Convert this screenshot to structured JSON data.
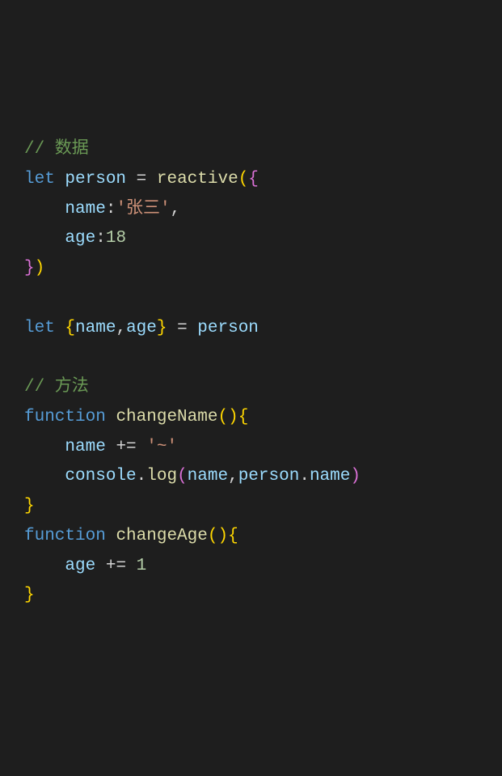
{
  "lines": {
    "l1_comment": "// 数据",
    "l2_let": "let",
    "l2_person": "person",
    "l2_eq": " = ",
    "l2_reactive": "reactive",
    "l2_paren_open": "(",
    "l2_brace_open": "{",
    "l3_indent": "    ",
    "l3_name_key": "name",
    "l3_colon": ":",
    "l3_name_val": "'张三'",
    "l3_comma": ",",
    "l4_indent": "    ",
    "l4_age_key": "age",
    "l4_colon": ":",
    "l4_age_val": "18",
    "l5_brace_close": "}",
    "l5_paren_close": ")",
    "l7_let": "let",
    "l7_brace_open": "{",
    "l7_name": "name",
    "l7_comma": ",",
    "l7_age": "age",
    "l7_brace_close": "}",
    "l7_eq": " = ",
    "l7_person": "person",
    "l9_comment": "// 方法",
    "l10_function": "function",
    "l10_fname": "changeName",
    "l10_parens": "()",
    "l10_brace": "{",
    "l11_indent": "    ",
    "l11_name": "name",
    "l11_op": " += ",
    "l11_val": "'~'",
    "l12_indent": "    ",
    "l12_console": "console",
    "l12_dot1": ".",
    "l12_log": "log",
    "l12_paren_open": "(",
    "l12_name": "name",
    "l12_comma": ",",
    "l12_person": "person",
    "l12_dot2": ".",
    "l12_pname": "name",
    "l12_paren_close": ")",
    "l13_brace": "}",
    "l14_function": "function",
    "l14_fname": "changeAge",
    "l14_parens": "()",
    "l14_brace": "{",
    "l15_indent": "    ",
    "l15_age": "age",
    "l15_op": " += ",
    "l15_val": "1",
    "l16_brace": "}"
  }
}
